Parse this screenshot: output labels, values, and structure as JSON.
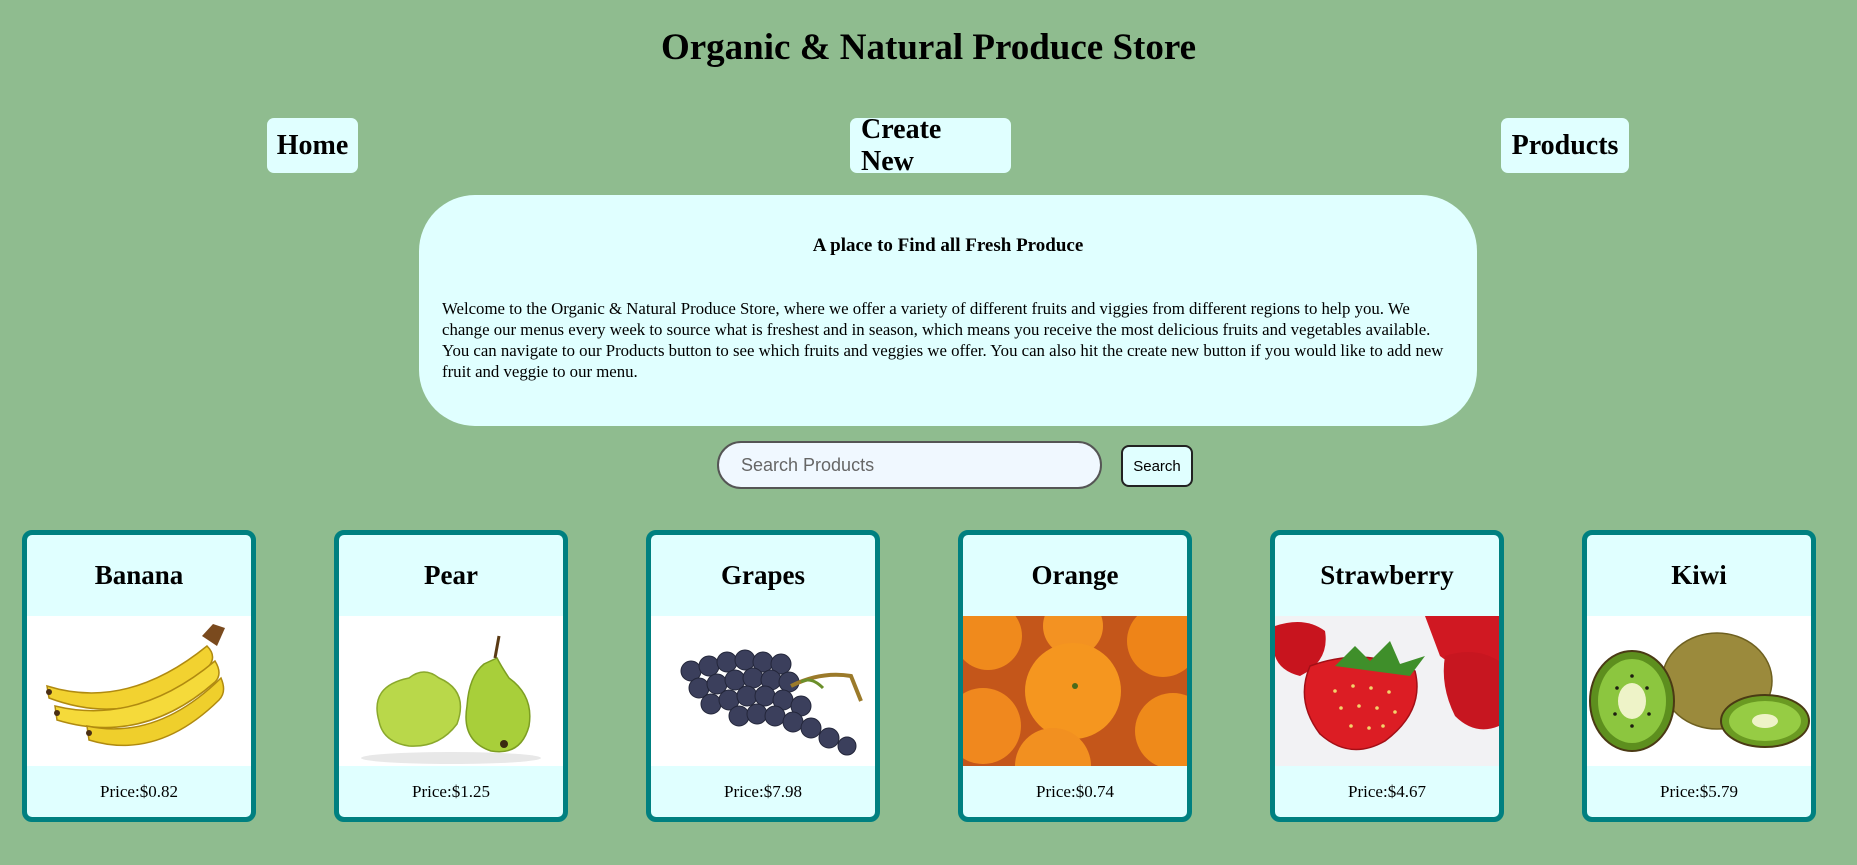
{
  "site": {
    "title": "Organic & Natural Produce Store"
  },
  "nav": {
    "home": "Home",
    "create_new": "Create New",
    "products": "Products"
  },
  "intro": {
    "heading": "A place to Find all Fresh Produce",
    "text": "Welcome to the Organic & Natural Produce Store, where we offer a variety of different fruits and viggies from different regions to help you. We change our menus every week to source what is freshest and in season, which means you receive the most delicious fruits and vegetables available. You can navigate to our Products button to see which fruits and veggies we offer. You can also hit the create new button if you would like to add new fruit and veggie to our menu."
  },
  "search": {
    "placeholder": "Search Products",
    "button_label": "Search"
  },
  "products": [
    {
      "name": "Banana",
      "price": "Price:$0.82",
      "image": "banana-image"
    },
    {
      "name": "Pear",
      "price": "Price:$1.25",
      "image": "pear-image"
    },
    {
      "name": "Grapes",
      "price": "Price:$7.98",
      "image": "grapes-image"
    },
    {
      "name": "Orange",
      "price": "Price:$0.74",
      "image": "orange-image"
    },
    {
      "name": "Strawberry",
      "price": "Price:$4.67",
      "image": "strawberry-image"
    },
    {
      "name": "Kiwi",
      "price": "Price:$5.79",
      "image": "kiwi-image"
    }
  ],
  "colors": {
    "page_background": "#8fbc8f",
    "panel_background": "#e0ffff",
    "card_border": "#008080"
  }
}
